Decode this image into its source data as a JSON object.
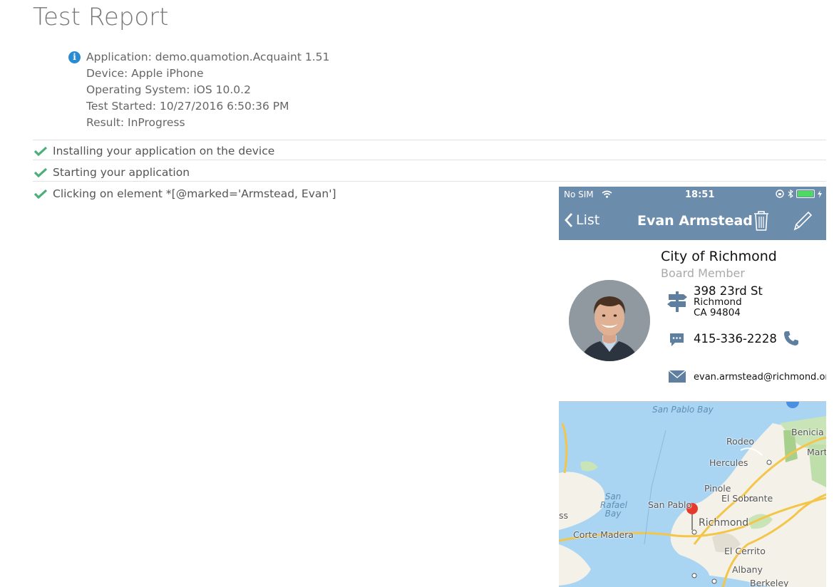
{
  "report": {
    "title": "Test Report",
    "info": {
      "application": "Application: demo.quamotion.Acquaint 1.51",
      "device": "Device: Apple iPhone",
      "os": "Operating System: iOS 10.0.2",
      "started": "Test Started: 10/27/2016 6:50:36 PM",
      "result": "Result: InProgress"
    },
    "steps": [
      {
        "label": "Installing your application on the device",
        "status": "passed"
      },
      {
        "label": "Starting your application",
        "status": "passed"
      },
      {
        "label": "Clicking on element *[@marked='Armstead, Evan']",
        "status": "passed"
      }
    ]
  },
  "device_screen": {
    "status_bar": {
      "carrier": "No SIM",
      "time": "18:51"
    },
    "nav": {
      "back_label": "List",
      "title": "Evan Armstead"
    },
    "contact": {
      "company": "City of Richmond",
      "position": "Board Member",
      "street": "398 23rd St",
      "city": "Richmond",
      "state_zip": "CA 94804",
      "phone": "415-336-2228",
      "email": "evan.armstead@richmond.org"
    },
    "map": {
      "labels": [
        "San Pablo Bay",
        "Rodeo",
        "Benicia",
        "Martinez",
        "Hercules",
        "Pinole",
        "El Sobrante",
        "San Pablo",
        "Richmond",
        "San Rafael Bay",
        "Corte Madera",
        "El Cerrito",
        "Albany",
        "Berkeley",
        "ss"
      ]
    }
  },
  "colors": {
    "accent": "#6c8cab",
    "check": "#4caf7a",
    "info": "#2a8bd0"
  }
}
